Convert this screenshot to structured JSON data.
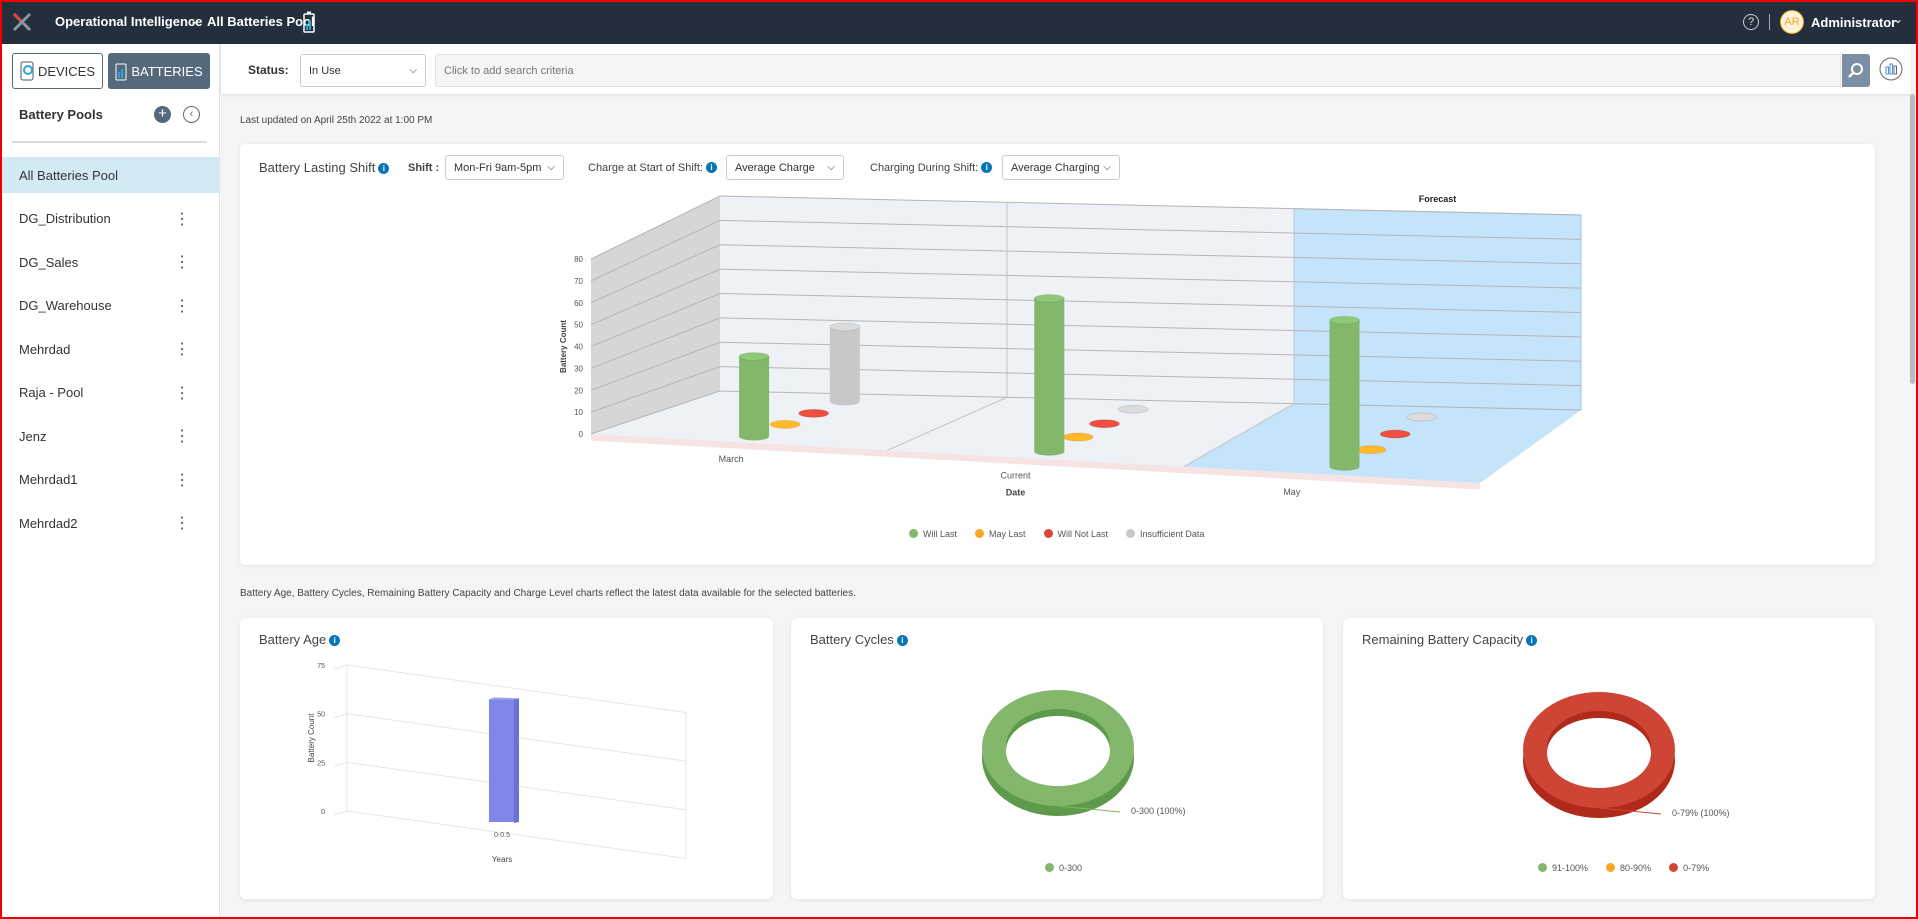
{
  "header": {
    "app_title": "Operational Intelligence",
    "separator": "-",
    "pool_title": "All Batteries Pool",
    "help_icon": "question-circle-icon",
    "avatar_initials": "AR",
    "user": "Administrator"
  },
  "sidebar": {
    "devices_label": "DEVICES",
    "batteries_label": "BATTERIES",
    "title": "Battery Pools",
    "items": [
      {
        "label": "All Batteries Pool",
        "active": true
      },
      {
        "label": "DG_Distribution"
      },
      {
        "label": "DG_Sales"
      },
      {
        "label": "DG_Warehouse"
      },
      {
        "label": "Mehrdad"
      },
      {
        "label": "Raja - Pool"
      },
      {
        "label": "Jenz"
      },
      {
        "label": "Mehrdad1"
      },
      {
        "label": "Mehrdad2"
      }
    ]
  },
  "filter": {
    "status_label": "Status:",
    "status_value": "In Use",
    "search_placeholder": "Click to add search criteria"
  },
  "main": {
    "last_updated": "Last updated on April 25th 2022 at 1:00 PM",
    "shift_card": {
      "title": "Battery Lasting Shift",
      "shift_label": "Shift :",
      "shift_value": "Mon-Fri 9am-5pm",
      "charge_label": "Charge at Start of Shift:",
      "charge_value": "Average Charge",
      "charging_label": "Charging During Shift:",
      "charging_value": "Average Charging"
    },
    "note": "Battery Age, Battery Cycles, Remaining Battery Capacity and Charge Level charts reflect the latest data available for the selected batteries.",
    "age_title": "Battery Age",
    "cycles_title": "Battery Cycles",
    "capacity_title": "Remaining Battery Capacity"
  },
  "chart_data": [
    {
      "type": "bar",
      "style": "3d-cylinder",
      "xlabel": "Date",
      "ylabel": "Battery Count",
      "ylim": [
        0,
        80
      ],
      "yticks": [
        "0",
        "10",
        "20",
        "30",
        "40",
        "50",
        "60",
        "70",
        "80"
      ],
      "categories": [
        "March",
        "Current",
        "May"
      ],
      "annotation": "Forecast",
      "forecast_category": "May",
      "series": [
        {
          "name": "Will Last",
          "color": "#82b76c",
          "values": [
            36,
            69,
            66
          ]
        },
        {
          "name": "May Last",
          "color": "#f9a825",
          "values": [
            0,
            0,
            0
          ]
        },
        {
          "name": "Will Not Last",
          "color": "#d9473a",
          "values": [
            0,
            0,
            0
          ]
        },
        {
          "name": "Insufficient Data",
          "color": "#c8c8c8",
          "values": [
            31,
            0,
            0
          ]
        }
      ],
      "legend": "bottom"
    },
    {
      "type": "bar",
      "style": "3d",
      "xlabel": "Years",
      "ylabel": "Battery Count",
      "ylim": [
        0,
        75
      ],
      "yticks": [
        "0",
        "25",
        "50",
        "75"
      ],
      "categories": [
        "0-0.5"
      ],
      "values": [
        63
      ],
      "color": "#7f86e8"
    },
    {
      "type": "pie",
      "style": "3d-donut",
      "slices": [
        {
          "label": "0-300",
          "value": 100,
          "color": "#82b76c"
        }
      ],
      "data_label": "0-300 (100%)",
      "legend": [
        "0-300"
      ]
    },
    {
      "type": "pie",
      "style": "3d-donut",
      "slices": [
        {
          "label": "91-100%",
          "value": 0,
          "color": "#82b76c"
        },
        {
          "label": "80-90%",
          "value": 0,
          "color": "#f9a825"
        },
        {
          "label": "0-79%",
          "value": 100,
          "color": "#cf4535"
        }
      ],
      "data_label": "0-79% (100%)",
      "legend": [
        "91-100%",
        "80-90%",
        "0-79%"
      ]
    }
  ]
}
